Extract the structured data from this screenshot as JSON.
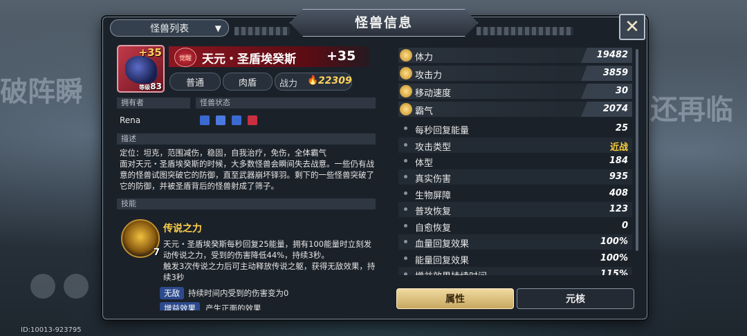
{
  "background": {
    "left_text": "破阵瞬",
    "right_text": "还再临",
    "id_text": "ID:10013-923795"
  },
  "panel": {
    "title": "怪兽信息",
    "close_icon": "close-x-icon",
    "dropdown_label": "怪兽列表"
  },
  "monster": {
    "plus_level": "+35",
    "level_prefix": "等级",
    "level": "83",
    "awaken_badge": "觉醒",
    "name": "天元・圣盾埃癸斯",
    "name_plus": "+35",
    "tags": [
      "普通",
      "肉盾"
    ],
    "power_label": "战力",
    "power_value": "22309"
  },
  "owner": {
    "header": "拥有者",
    "name": "Rena",
    "status_header": "怪兽状态",
    "status_icons": [
      "shield-buff-icon",
      "armor-buff-icon",
      "defense-buff-icon",
      "heal-buff-icon"
    ]
  },
  "description": {
    "header": "描述",
    "text_line1": "定位：坦克，范围减伤，稳固，自我治疗，免伤，全体霸气",
    "text_body": "面对天元・圣盾埃癸斯的时候，大多数怪兽会瞬间失去战意。一些仍有战意的怪兽试图突破它的防御，直至武器崩坏铎羽。剩下的一些怪兽突破了它的防御，并被圣盾背后的怪兽射成了筛子。"
  },
  "skill": {
    "header": "技能",
    "level": "7",
    "name": "传说之力",
    "desc1": "天元・圣盾埃癸斯每秒回复25能量，拥有100能量时立刻发动传说之力，受到的伤害降低44%，持续3秒。",
    "desc2": "触发3次传说之力后可主动释放传说之躯，获得无敌效果，持续3秒",
    "effects": [
      {
        "tag": "无敌",
        "text": "持续时间内受到的伤害变为0"
      },
      {
        "tag": "增益效果",
        "text": "产生正面的效果"
      }
    ]
  },
  "stats_main": [
    {
      "label": "体力",
      "value": "19482",
      "icon": "heart-icon"
    },
    {
      "label": "攻击力",
      "value": "3859",
      "icon": "sword-icon"
    },
    {
      "label": "移动速度",
      "value": "30",
      "icon": "speed-icon"
    },
    {
      "label": "霸气",
      "value": "2074",
      "icon": "claw-icon"
    }
  ],
  "stats_sub": [
    {
      "label": "每秒回复能量",
      "value": "25"
    },
    {
      "label": "攻击类型",
      "value": "近战"
    },
    {
      "label": "体型",
      "value": "184"
    },
    {
      "label": "真实伤害",
      "value": "935"
    },
    {
      "label": "生物屏障",
      "value": "408"
    },
    {
      "label": "普攻恢复",
      "value": "123"
    },
    {
      "label": "自愈恢复",
      "value": "0"
    },
    {
      "label": "血量回复效果",
      "value": "100%"
    },
    {
      "label": "能量回复效果",
      "value": "100%"
    },
    {
      "label": "增益效果持续时间",
      "value": "115%"
    }
  ],
  "tabs": {
    "attributes": "属性",
    "core": "元核"
  },
  "colors": {
    "gold": "#ffd35a",
    "name_band": "#8c1620",
    "effect_tag": "#2c4a8c",
    "active_tab": "#e6c98a"
  }
}
